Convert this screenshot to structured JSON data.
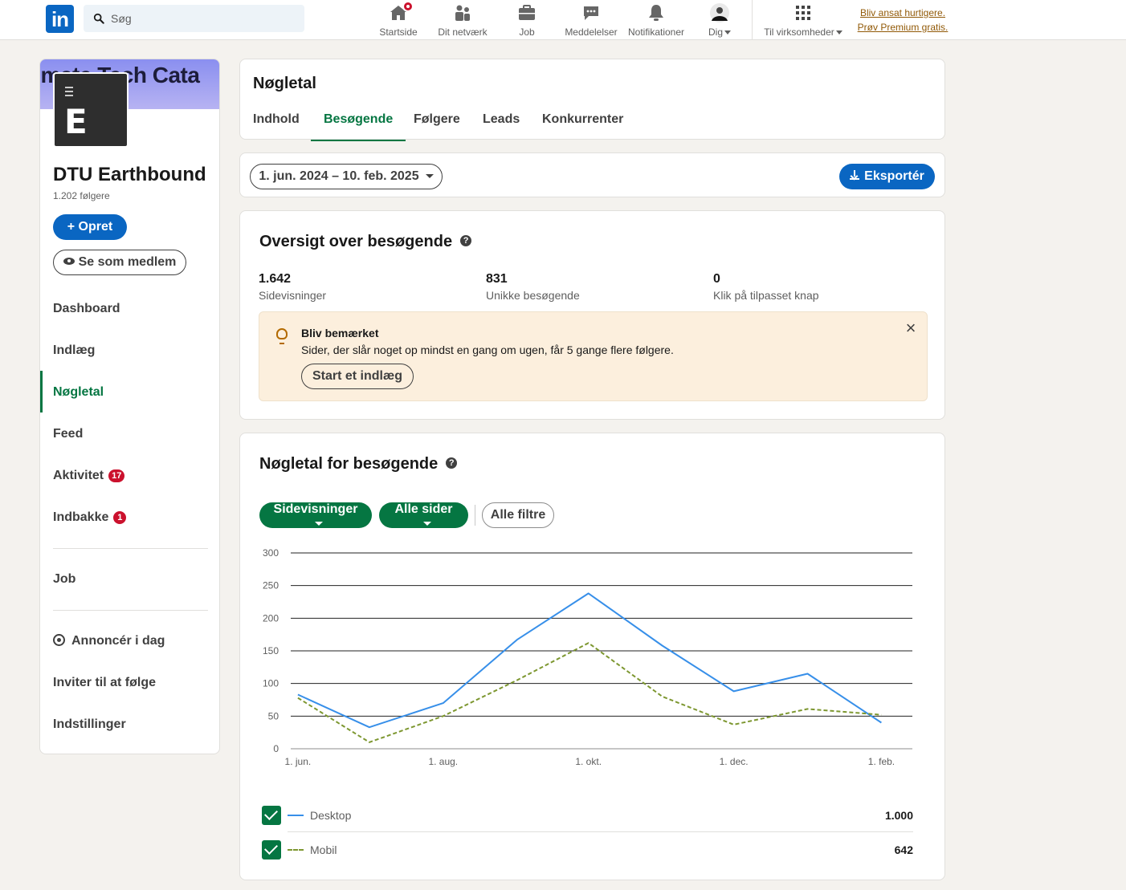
{
  "nav": {
    "search_placeholder": "Søg",
    "items": [
      {
        "label": "Startside",
        "icon": "home-icon"
      },
      {
        "label": "Dit netværk",
        "icon": "network-icon"
      },
      {
        "label": "Job",
        "icon": "briefcase-icon"
      },
      {
        "label": "Meddelelser",
        "icon": "messaging-icon"
      },
      {
        "label": "Notifikationer",
        "icon": "bell-icon"
      },
      {
        "label": "Dig",
        "icon": "avatar"
      },
      {
        "label": "Til virksomheder",
        "icon": "grid-icon"
      }
    ],
    "premium_line1": "Bliv ansat hurtigere.",
    "premium_line2": "Prøv Premium gratis."
  },
  "sidebar": {
    "cover_text": "limate Tech Cata",
    "org_name": "DTU Earthbound",
    "followers": "1.202 følgere",
    "create_label": "+ Opret",
    "view_label": "Se som medlem",
    "menu": [
      {
        "label": "Dashboard"
      },
      {
        "label": "Indlæg"
      },
      {
        "label": "Nøgletal",
        "active": true
      },
      {
        "label": "Feed"
      },
      {
        "label": "Aktivitet",
        "badge": "17"
      },
      {
        "label": "Indbakke",
        "badge": "1"
      }
    ],
    "job_label": "Job",
    "advertise_label": "Annoncér i dag",
    "invite_label": "Inviter til at følge",
    "settings_label": "Indstillinger"
  },
  "header": {
    "title": "Nøgletal",
    "tabs": [
      "Indhold",
      "Besøgende",
      "Følgere",
      "Leads",
      "Konkurrenter"
    ],
    "active_tab": "Besøgende"
  },
  "toolbar": {
    "date_range": "1. jun. 2024 – 10. feb. 2025",
    "export_label": "Eksportér"
  },
  "overview": {
    "title": "Oversigt over besøgende",
    "stats": [
      {
        "value": "1.642",
        "label": "Sidevisninger"
      },
      {
        "value": "831",
        "label": "Unikke besøgende"
      },
      {
        "value": "0",
        "label": "Klik på tilpasset knap"
      }
    ],
    "notice": {
      "title": "Bliv bemærket",
      "text": "Sider, der slår noget op mindst en gang om ugen, får 5 gange flere følgere.",
      "button": "Start et indlæg"
    }
  },
  "metrics": {
    "title": "Nøgletal for besøgende",
    "filter_metric": "Sidevisninger",
    "filter_pages": "Alle sider",
    "all_filters": "Alle filtre",
    "legend": [
      {
        "name": "Desktop",
        "total": "1.000"
      },
      {
        "name": "Mobil",
        "total": "642"
      }
    ]
  },
  "chart_data": {
    "type": "line",
    "x": [
      "2024-06-01",
      "2024-07-01",
      "2024-08-01",
      "2024-09-01",
      "2024-10-01",
      "2024-11-01",
      "2024-12-01",
      "2025-01-01",
      "2025-02-01"
    ],
    "x_tick_labels": [
      "1. jun.",
      "1. aug.",
      "1. okt.",
      "1. dec.",
      "1. feb."
    ],
    "series": [
      {
        "name": "Desktop",
        "color": "#378fe9",
        "style": "solid",
        "values": [
          83,
          33,
          70,
          167,
          238,
          158,
          88,
          115,
          40
        ]
      },
      {
        "name": "Mobil",
        "color": "#7d9730",
        "style": "dashed",
        "values": [
          78,
          10,
          50,
          105,
          162,
          80,
          37,
          61,
          52
        ]
      }
    ],
    "ylim": [
      0,
      300
    ],
    "yticks": [
      0,
      50,
      100,
      150,
      200,
      250,
      300
    ],
    "grid": true
  }
}
